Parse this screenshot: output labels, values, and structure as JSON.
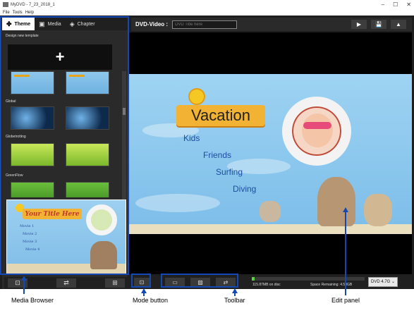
{
  "window": {
    "title": "MyDVD - 7_23_2018_1",
    "controls": [
      "–",
      "☐",
      "✕"
    ]
  },
  "menu": [
    "File",
    "Tools",
    "Help"
  ],
  "tabs": [
    {
      "label": "Theme",
      "icon": "theme-icon",
      "glyph": "✤"
    },
    {
      "label": "Media",
      "icon": "film-icon",
      "glyph": "▣"
    },
    {
      "label": "Chapter",
      "icon": "layers-icon",
      "glyph": "◈"
    }
  ],
  "media_browser": {
    "design_label": "Design new template",
    "new_template_glyph": "+",
    "groups": [
      "Global",
      "Globetrotting",
      "GreenFlow"
    ],
    "preview": {
      "banner": "Your Title Here",
      "menu_items": [
        "Movie 1",
        "Movie 2",
        "Movie 3",
        "Movie 4"
      ]
    },
    "footer_buttons": [
      {
        "icon": "add-to-disc-icon",
        "glyph": "⊡"
      },
      {
        "icon": "swap-icon",
        "glyph": "⇄"
      },
      {
        "icon": "add-icon",
        "glyph": "⊞"
      }
    ]
  },
  "dvd_bar": {
    "label": "DVD-Video :",
    "title_placeholder": "DVD Title here",
    "controls": [
      {
        "icon": "play-icon",
        "glyph": "▶"
      },
      {
        "icon": "save-icon",
        "glyph": "💾"
      },
      {
        "icon": "burn-icon",
        "glyph": "▲"
      }
    ]
  },
  "menu_preview": {
    "title": "Vacation",
    "items": [
      "Kids",
      "Friends",
      "Surfing",
      "Diving"
    ]
  },
  "bottom_bar": {
    "mode_glyph": "⊡",
    "toolbar": [
      {
        "icon": "folder-icon",
        "glyph": "▭"
      },
      {
        "icon": "image-icon",
        "glyph": "▨"
      },
      {
        "icon": "swap-icon",
        "glyph": "⇄"
      }
    ],
    "used": "115.87MB on disc",
    "remaining": "Space Remaining: 4.58GB",
    "disc_type": "DVD 4.7G",
    "usage_fraction": 0.025
  },
  "callouts": {
    "media_browser": "Media Browser",
    "mode_button": "Mode button",
    "toolbar": "Toolbar",
    "edit_panel": "Edit panel"
  },
  "colors": {
    "callout_blue": "#1448b4",
    "progress_green": "#5bd13b",
    "banner_orange": "#f2b233"
  }
}
